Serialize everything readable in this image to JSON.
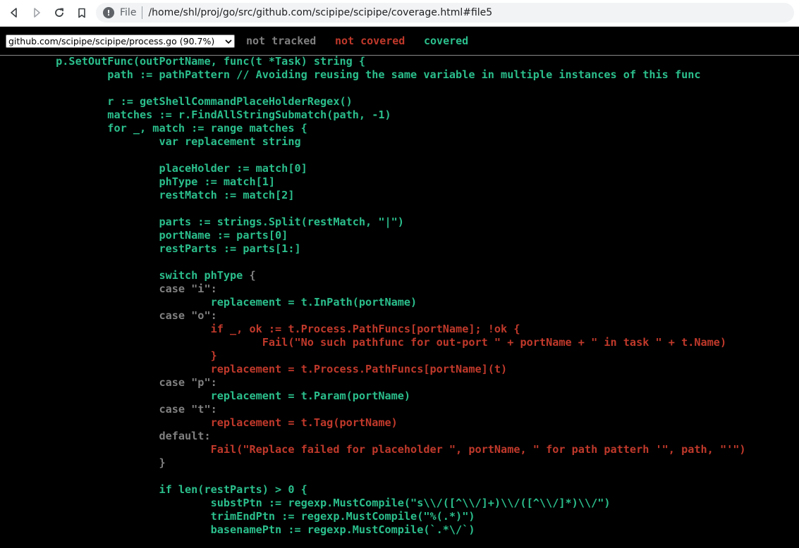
{
  "browser": {
    "scheme_label": "File",
    "url": "/home/shl/proj/go/src/github.com/scipipe/scipipe/coverage.html#file5",
    "info_icon": "info-icon",
    "back_icon": "arrow-left-icon",
    "forward_icon": "arrow-right-icon",
    "reload_icon": "reload-icon",
    "bookmark_icon": "bookmark-icon"
  },
  "topbar": {
    "file_select": "github.com/scipipe/scipipe/process.go (90.7%)",
    "legend": {
      "not_tracked": "not tracked",
      "not_covered": "not covered",
      "covered": "covered"
    }
  },
  "colors": {
    "covered": "#2bbf8c",
    "not_covered": "#c0392b",
    "not_tracked": "#808080",
    "background": "#000000"
  },
  "code_lines": [
    [
      {
        "t": "\tp.SetOutFunc(outPortName, func(t *Task) string {",
        "c": "cov1"
      }
    ],
    [
      {
        "t": "\t\tpath := pathPattern // Avoiding reusing the same variable in multiple instances of this func",
        "c": "cov1"
      }
    ],
    [
      {
        "t": "",
        "c": "nt"
      }
    ],
    [
      {
        "t": "\t\tr := getShellCommandPlaceHolderRegex()",
        "c": "cov1"
      }
    ],
    [
      {
        "t": "\t\tmatches := r.FindAllStringSubmatch(path, -1)",
        "c": "cov1"
      }
    ],
    [
      {
        "t": "\t\tfor _, match := range matches {",
        "c": "cov1"
      }
    ],
    [
      {
        "t": "\t\t\tvar replacement string",
        "c": "cov1"
      }
    ],
    [
      {
        "t": "",
        "c": "nt"
      }
    ],
    [
      {
        "t": "\t\t\tplaceHolder := match[0]",
        "c": "cov1"
      }
    ],
    [
      {
        "t": "\t\t\tphType := match[1]",
        "c": "cov1"
      }
    ],
    [
      {
        "t": "\t\t\trestMatch := match[2]",
        "c": "cov1"
      }
    ],
    [
      {
        "t": "",
        "c": "nt"
      }
    ],
    [
      {
        "t": "\t\t\tparts := strings.Split(restMatch, \"|\")",
        "c": "cov1"
      }
    ],
    [
      {
        "t": "\t\t\tportName := parts[0]",
        "c": "cov1"
      }
    ],
    [
      {
        "t": "\t\t\trestParts := parts[1:]",
        "c": "cov1"
      }
    ],
    [
      {
        "t": "",
        "c": "nt"
      }
    ],
    [
      {
        "t": "\t\t\tswitch phType ",
        "c": "cov1"
      },
      {
        "t": "{",
        "c": "nt"
      }
    ],
    [
      {
        "t": "\t\t\tcase \"i\":",
        "c": "nt"
      }
    ],
    [
      {
        "t": "\t\t\t\treplacement = t.InPath(portName)",
        "c": "cov1"
      }
    ],
    [
      {
        "t": "\t\t\tcase \"o\":",
        "c": "nt"
      }
    ],
    [
      {
        "t": "\t\t\t\tif _, ok := t.Process.PathFuncs[portName]; !ok {",
        "c": "cov0"
      }
    ],
    [
      {
        "t": "\t\t\t\t\tFail(\"No such pathfunc for out-port \" + portName + \" in task \" + t.Name)",
        "c": "cov0"
      }
    ],
    [
      {
        "t": "\t\t\t\t}",
        "c": "cov0"
      }
    ],
    [
      {
        "t": "\t\t\t\treplacement = t.Process.PathFuncs[portName](t)",
        "c": "cov0"
      }
    ],
    [
      {
        "t": "\t\t\tcase \"p\":",
        "c": "nt"
      }
    ],
    [
      {
        "t": "\t\t\t\treplacement = t.Param(portName)",
        "c": "cov1"
      }
    ],
    [
      {
        "t": "\t\t\tcase \"t\":",
        "c": "nt"
      }
    ],
    [
      {
        "t": "\t\t\t\treplacement = t.Tag(portName)",
        "c": "cov0"
      }
    ],
    [
      {
        "t": "\t\t\tdefault:",
        "c": "nt"
      }
    ],
    [
      {
        "t": "\t\t\t\tFail(\"Replace failed for placeholder \", portName, \" for path patterh '\", path, \"'\")",
        "c": "cov0"
      }
    ],
    [
      {
        "t": "\t\t\t}",
        "c": "nt"
      }
    ],
    [
      {
        "t": "",
        "c": "nt"
      }
    ],
    [
      {
        "t": "\t\t\tif len(restParts) > 0 {",
        "c": "cov1"
      }
    ],
    [
      {
        "t": "\t\t\t\tsubstPtn := regexp.MustCompile(\"s\\\\/([^\\\\/]+)\\\\/([^\\\\/]*)\\\\/\")",
        "c": "cov1"
      }
    ],
    [
      {
        "t": "\t\t\t\ttrimEndPtn := regexp.MustCompile(\"%(.*)\")",
        "c": "cov1"
      }
    ],
    [
      {
        "t": "\t\t\t\tbasenamePtn := regexp.MustCompile(`.*\\/`)",
        "c": "cov1"
      }
    ]
  ]
}
